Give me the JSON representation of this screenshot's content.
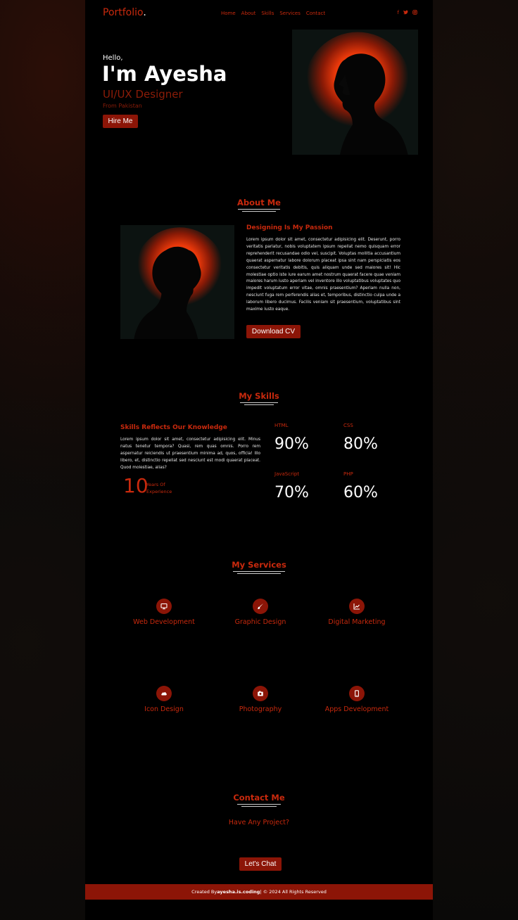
{
  "nav": {
    "logo": "Portfolio",
    "logo_dot": ".",
    "menu": [
      "Home",
      "About",
      "Skills",
      "Services",
      "Contact"
    ],
    "social_icons": [
      "facebook-icon",
      "twitter-icon",
      "instagram-icon"
    ]
  },
  "hero": {
    "greeting": "Hello,",
    "name": "I'm Ayesha",
    "role": "UI/UX Designer",
    "location": "From Pakistan",
    "button": "Hire Me"
  },
  "about": {
    "title": "About Me",
    "heading": "Designing Is My Passion",
    "text": "Lorem ipsum dolor sit amet, consectetur adipisicing elit. Deserunt, porro veritatis pariatur, nobis voluptatem ipsum repellat nemo quisquam error reprehenderit recusandae odio vel, suscipit. Voluptas mollitia accusantium quaerat aspernatur labore dolorum placeat ipsa sint nam perspiciatis eos consectetur veritatis debitis, quis aliquam unde sed maiores sit! Hic molestiae optio iste iure earum amet nostrum quaerat facere quae veniam maiores harum iusto aperiam vel inventore illo voluptatibus voluptates quo impedit voluptatum error vitae, omnis praesentium? Aperiam nulla non, nesciunt fuga rem perferendis alias et, temporibus, distinctio culpa unde a laborum libero ducimus. Facilis veniam sit praesentium, voluptatibus sint maxime iusto eaque.",
    "button": "Download CV"
  },
  "skills": {
    "title": "My Skills",
    "heading": "Skills Reflects Our Knowledge",
    "text": "Lorem ipsum dolor sit amet, consectetur adipisicing elit. Minus natus tenetur tempora? Quasi, rem quas omnis. Porro rem aspernatur reiciendis ut praesentium minima ad, quos, officia! Illo libero, et, distinctio repellat sed nesciunt est modi quaerat placeat. Quod molestiae, alias?",
    "years": "10",
    "years_label_1": "Years Of",
    "years_label_2": "Experience",
    "items": [
      {
        "name": "HTML",
        "value": "90%"
      },
      {
        "name": "CSS",
        "value": "80%"
      },
      {
        "name": "JavaScript",
        "value": "70%"
      },
      {
        "name": "PHP",
        "value": "60%"
      }
    ]
  },
  "services": {
    "title": "My Services",
    "items": [
      {
        "label": "Web Development",
        "icon": "desktop-icon"
      },
      {
        "label": "Graphic Design",
        "icon": "brush-icon"
      },
      {
        "label": "Digital Marketing",
        "icon": "chart-icon"
      },
      {
        "label": "Icon Design",
        "icon": "cloud-icon"
      },
      {
        "label": "Photography",
        "icon": "camera-icon"
      },
      {
        "label": "Apps Development",
        "icon": "mobile-icon"
      }
    ]
  },
  "contact": {
    "title": "Contact Me",
    "question": "Have Any Project?",
    "button": "Let's Chat"
  },
  "footer": {
    "prefix": "Created By ",
    "author": "ayesha.is.coding",
    "suffix": " | © 2024 All Rights Reserved"
  },
  "colors": {
    "accent": "#c8290d",
    "button": "#8c1507",
    "background": "#000000"
  }
}
